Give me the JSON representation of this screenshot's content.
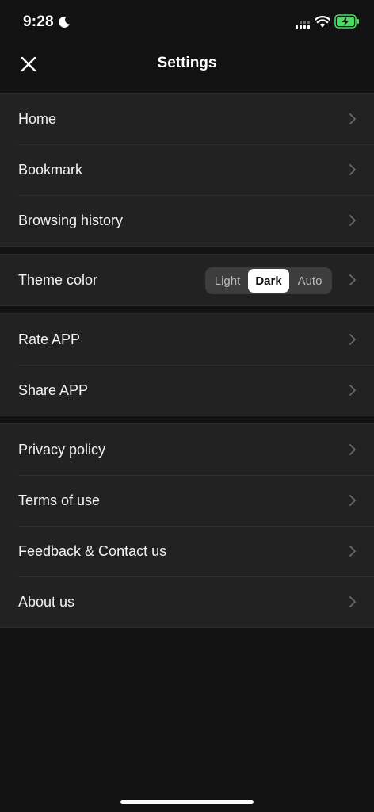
{
  "status_bar": {
    "time": "9:28",
    "icons": [
      "moon-icon",
      "signal-icon",
      "wifi-icon",
      "battery-charging-icon"
    ],
    "battery_color": "#4cd964"
  },
  "nav": {
    "title": "Settings",
    "close_icon": "close-icon"
  },
  "groups": [
    {
      "items": [
        {
          "label": "Home"
        },
        {
          "label": "Bookmark"
        },
        {
          "label": "Browsing history"
        }
      ]
    },
    {
      "items": [
        {
          "label": "Theme color",
          "segments": [
            "Light",
            "Dark",
            "Auto"
          ],
          "selected": "Dark"
        }
      ]
    },
    {
      "items": [
        {
          "label": "Rate APP"
        },
        {
          "label": "Share APP"
        }
      ]
    },
    {
      "items": [
        {
          "label": "Privacy policy"
        },
        {
          "label": "Terms of use"
        },
        {
          "label": "Feedback & Contact us"
        },
        {
          "label": "About us"
        }
      ]
    }
  ],
  "colors": {
    "background": "#121212",
    "row_background": "#222222",
    "text": "#f2f2f2",
    "chevron": "#6a6a6a",
    "segment_active": "#ffffff"
  }
}
